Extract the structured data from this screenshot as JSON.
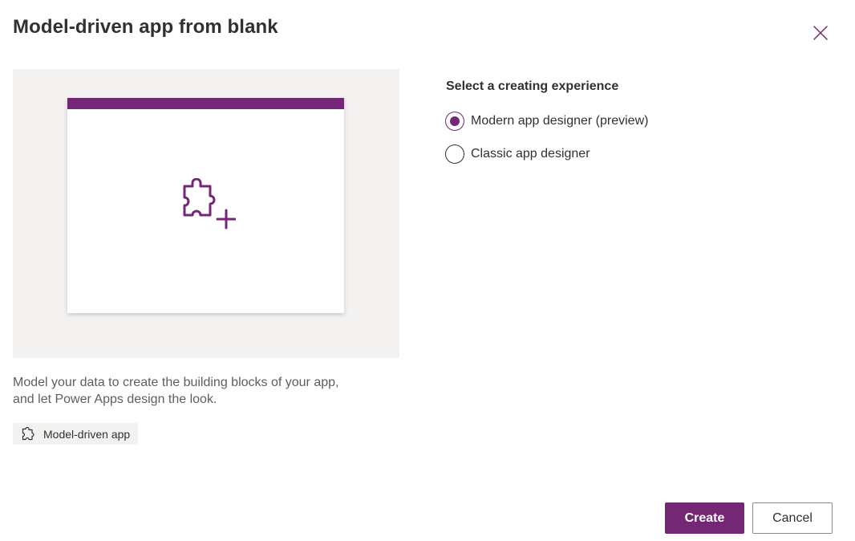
{
  "dialog": {
    "title": "Model-driven app from blank",
    "close_icon": "close-icon",
    "accent_color": "#742774"
  },
  "preview": {
    "icon": "puzzle-add-icon",
    "description": "Model your data to create the building blocks of your app, and let Power Apps design the look.",
    "tag": {
      "icon": "puzzle-icon",
      "label": "Model-driven app"
    }
  },
  "options": {
    "heading": "Select a creating experience",
    "items": [
      {
        "label": "Modern app designer (preview)",
        "checked": true
      },
      {
        "label": "Classic app designer",
        "checked": false
      }
    ]
  },
  "footer": {
    "create_label": "Create",
    "cancel_label": "Cancel"
  }
}
